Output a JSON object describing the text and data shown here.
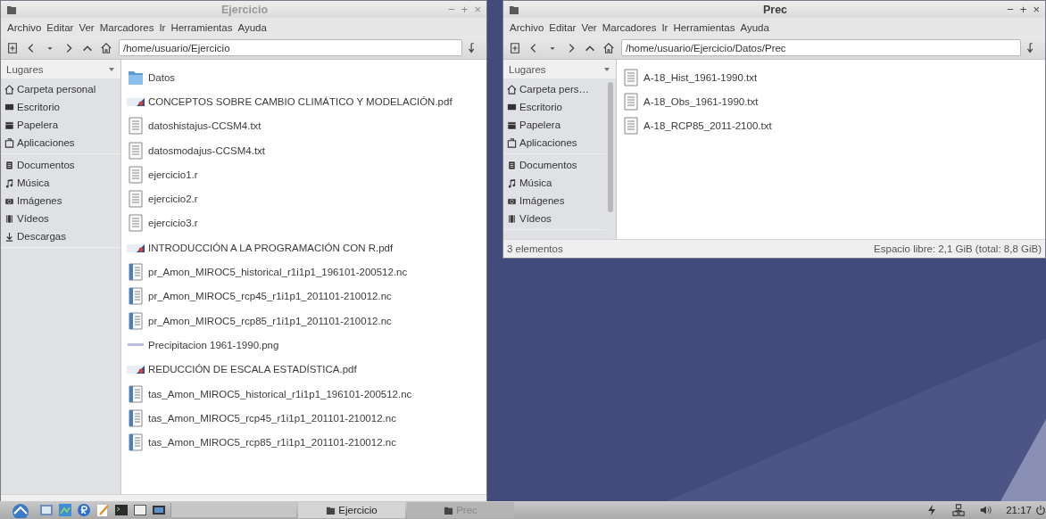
{
  "windows": [
    {
      "title": "Ejercicio",
      "active": false,
      "controls": [
        "−",
        "+",
        "×"
      ],
      "menu": [
        "Archivo",
        "Editar",
        "Ver",
        "Marcadores",
        "Ir",
        "Herramientas",
        "Ayuda"
      ],
      "path": "/home/usuario/Ejercicio",
      "sidebar": {
        "header": "Lugares",
        "scrollbar": false,
        "groups": [
          [
            {
              "label": "Carpeta personal",
              "kind": "home"
            },
            {
              "label": "Escritorio",
              "kind": "desktop"
            },
            {
              "label": "Papelera",
              "kind": "trash"
            },
            {
              "label": "Aplicaciones",
              "kind": "apps"
            }
          ],
          [
            {
              "label": "Documentos",
              "kind": "docs"
            },
            {
              "label": "Música",
              "kind": "music"
            },
            {
              "label": "Imágenes",
              "kind": "images"
            },
            {
              "label": "Vídeos",
              "kind": "video"
            },
            {
              "label": "Descargas",
              "kind": "download"
            }
          ]
        ]
      },
      "files": [
        {
          "name": "Datos",
          "kind": "folder"
        },
        {
          "name": "CONCEPTOS SOBRE CAMBIO CLIMÁTICO Y MODELACIÓN.pdf",
          "kind": "pdf"
        },
        {
          "name": "datoshistajus-CCSM4.txt",
          "kind": "text"
        },
        {
          "name": "datosmodajus-CCSM4.txt",
          "kind": "text"
        },
        {
          "name": "ejercicio1.r",
          "kind": "text"
        },
        {
          "name": "ejercicio2.r",
          "kind": "text"
        },
        {
          "name": "ejercicio3.r",
          "kind": "text"
        },
        {
          "name": "INTRODUCCIÓN A LA PROGRAMACIÓN CON R.pdf",
          "kind": "pdf"
        },
        {
          "name": "pr_Amon_MIROC5_historical_r1i1p1_196101-200512.nc",
          "kind": "data"
        },
        {
          "name": "pr_Amon_MIROC5_rcp45_r1i1p1_201101-210012.nc",
          "kind": "data"
        },
        {
          "name": "pr_Amon_MIROC5_rcp85_r1i1p1_201101-210012.nc",
          "kind": "data"
        },
        {
          "name": "Precipitacion 1961-1990.png",
          "kind": "image"
        },
        {
          "name": "REDUCCIÓN DE ESCALA ESTADÍSTICA.pdf",
          "kind": "pdf"
        },
        {
          "name": "tas_Amon_MIROC5_historical_r1i1p1_196101-200512.nc",
          "kind": "data"
        },
        {
          "name": "tas_Amon_MIROC5_rcp45_r1i1p1_201101-210012.nc",
          "kind": "data"
        },
        {
          "name": "tas_Amon_MIROC5_rcp85_r1i1p1_201101-210012.nc",
          "kind": "data"
        }
      ]
    },
    {
      "title": "Prec",
      "active": true,
      "controls": [
        "−",
        "+",
        "×"
      ],
      "menu": [
        "Archivo",
        "Editar",
        "Ver",
        "Marcadores",
        "Ir",
        "Herramientas",
        "Ayuda"
      ],
      "path": "/home/usuario/Ejercicio/Datos/Prec",
      "sidebar": {
        "header": "Lugares",
        "scrollbar": true,
        "groups": [
          [
            {
              "label": "Carpeta pers…",
              "kind": "home"
            },
            {
              "label": "Escritorio",
              "kind": "desktop"
            },
            {
              "label": "Papelera",
              "kind": "trash"
            },
            {
              "label": "Aplicaciones",
              "kind": "apps"
            }
          ],
          [
            {
              "label": "Documentos",
              "kind": "docs"
            },
            {
              "label": "Música",
              "kind": "music"
            },
            {
              "label": "Imágenes",
              "kind": "images"
            },
            {
              "label": "Vídeos",
              "kind": "video"
            }
          ]
        ]
      },
      "files": [
        {
          "name": "A-18_Hist_1961-1990.txt",
          "kind": "text"
        },
        {
          "name": "A-18_Obs_1961-1990.txt",
          "kind": "text"
        },
        {
          "name": "A-18_RCP85_2011-2100.txt",
          "kind": "text"
        }
      ],
      "status": {
        "count": "3 elementos",
        "free": "Espacio libre: 2,1 GiB (total: 8,8 GiB)"
      }
    }
  ],
  "taskbar": {
    "launchers": [
      {
        "kind": "files"
      },
      {
        "kind": "apps"
      },
      {
        "kind": "r"
      },
      {
        "kind": "editor"
      },
      {
        "kind": "terminal"
      },
      {
        "kind": "window"
      },
      {
        "kind": "desktop"
      }
    ],
    "tasks": [
      {
        "label": "Ejercicio",
        "selected": true
      },
      {
        "label": "Prec",
        "selected": false
      }
    ],
    "clock": "21:17"
  }
}
